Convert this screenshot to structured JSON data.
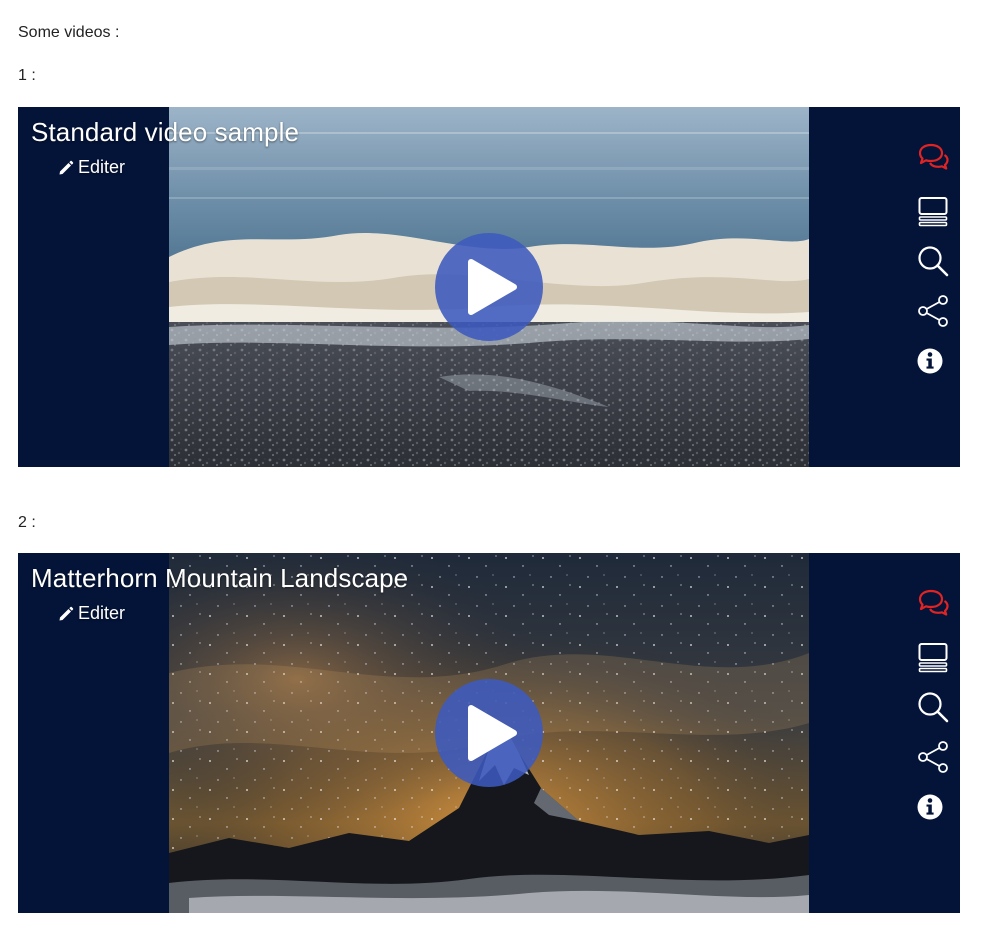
{
  "intro_text": "Some videos :",
  "videos": [
    {
      "index_label": "1 :",
      "title": "Standard video sample",
      "edit_label": "Editer",
      "scene": "ocean-wave-on-pebble-beach"
    },
    {
      "index_label": "2 :",
      "title": "Matterhorn Mountain Landscape",
      "edit_label": "Editer",
      "scene": "matterhorn-under-starry-night-sky"
    }
  ],
  "toolbar_icons": [
    "comments-icon",
    "chapters-icon",
    "search-icon",
    "share-icon",
    "info-icon"
  ],
  "colors": {
    "player_background": "#041439",
    "play_button": "#3c5abe",
    "comments_icon": "#e02424",
    "toolbar_icon": "#ffffff"
  }
}
